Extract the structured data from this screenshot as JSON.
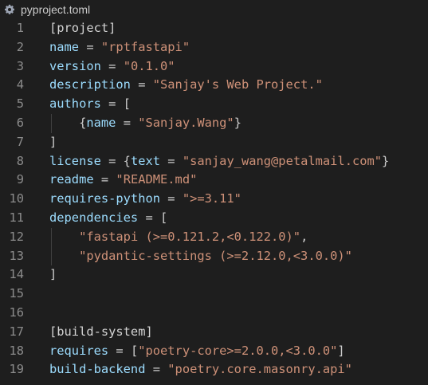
{
  "tab": {
    "filename": "pyproject.toml",
    "icon": "gear-icon"
  },
  "colors": {
    "background": "#1e1e1e",
    "key": "#9cdcfe",
    "string": "#ce9178",
    "punctuation": "#d4d4d4",
    "line_number": "#8b8b8b"
  },
  "lines": [
    {
      "n": "1",
      "tokens": [
        {
          "t": "[project]",
          "c": "sec"
        }
      ]
    },
    {
      "n": "2",
      "tokens": [
        {
          "t": "name",
          "c": "key"
        },
        {
          "t": " = ",
          "c": "plain"
        },
        {
          "t": "\"rptfastapi\"",
          "c": "str"
        }
      ]
    },
    {
      "n": "3",
      "tokens": [
        {
          "t": "version",
          "c": "key"
        },
        {
          "t": " = ",
          "c": "plain"
        },
        {
          "t": "\"0.1.0\"",
          "c": "str"
        }
      ]
    },
    {
      "n": "4",
      "tokens": [
        {
          "t": "description",
          "c": "key"
        },
        {
          "t": " = ",
          "c": "plain"
        },
        {
          "t": "\"Sanjay's Web Project.\"",
          "c": "str"
        }
      ]
    },
    {
      "n": "5",
      "tokens": [
        {
          "t": "authors",
          "c": "key"
        },
        {
          "t": " = [",
          "c": "plain"
        }
      ]
    },
    {
      "n": "6",
      "tokens": [
        {
          "t": "    {",
          "c": "plain"
        },
        {
          "t": "name",
          "c": "key"
        },
        {
          "t": " = ",
          "c": "plain"
        },
        {
          "t": "\"Sanjay.Wang\"",
          "c": "str"
        },
        {
          "t": "}",
          "c": "plain"
        }
      ]
    },
    {
      "n": "7",
      "tokens": [
        {
          "t": "]",
          "c": "plain"
        }
      ]
    },
    {
      "n": "8",
      "tokens": [
        {
          "t": "license",
          "c": "key"
        },
        {
          "t": " = {",
          "c": "plain"
        },
        {
          "t": "text",
          "c": "key"
        },
        {
          "t": " = ",
          "c": "plain"
        },
        {
          "t": "\"sanjay_wang@petalmail.com\"",
          "c": "str"
        },
        {
          "t": "}",
          "c": "plain"
        }
      ]
    },
    {
      "n": "9",
      "tokens": [
        {
          "t": "readme",
          "c": "key"
        },
        {
          "t": " = ",
          "c": "plain"
        },
        {
          "t": "\"README.md\"",
          "c": "str"
        }
      ]
    },
    {
      "n": "10",
      "tokens": [
        {
          "t": "requires-python",
          "c": "key"
        },
        {
          "t": " = ",
          "c": "plain"
        },
        {
          "t": "\">=3.11\"",
          "c": "str"
        }
      ]
    },
    {
      "n": "11",
      "tokens": [
        {
          "t": "dependencies",
          "c": "key"
        },
        {
          "t": " = [",
          "c": "plain"
        }
      ]
    },
    {
      "n": "12",
      "tokens": [
        {
          "t": "    ",
          "c": "plain"
        },
        {
          "t": "\"fastapi (>=0.121.2,<0.122.0)\"",
          "c": "str"
        },
        {
          "t": ",",
          "c": "plain"
        }
      ]
    },
    {
      "n": "13",
      "tokens": [
        {
          "t": "    ",
          "c": "plain"
        },
        {
          "t": "\"pydantic-settings (>=2.12.0,<3.0.0)\"",
          "c": "str"
        }
      ]
    },
    {
      "n": "14",
      "tokens": [
        {
          "t": "]",
          "c": "plain"
        }
      ]
    },
    {
      "n": "15",
      "tokens": []
    },
    {
      "n": "16",
      "tokens": []
    },
    {
      "n": "17",
      "tokens": [
        {
          "t": "[build-system]",
          "c": "sec"
        }
      ]
    },
    {
      "n": "18",
      "tokens": [
        {
          "t": "requires",
          "c": "key"
        },
        {
          "t": " = [",
          "c": "plain"
        },
        {
          "t": "\"poetry-core>=2.0.0,<3.0.0\"",
          "c": "str"
        },
        {
          "t": "]",
          "c": "plain"
        }
      ]
    },
    {
      "n": "19",
      "tokens": [
        {
          "t": "build-backend",
          "c": "key"
        },
        {
          "t": " = ",
          "c": "plain"
        },
        {
          "t": "\"poetry.core.masonry.api\"",
          "c": "str"
        }
      ]
    }
  ]
}
